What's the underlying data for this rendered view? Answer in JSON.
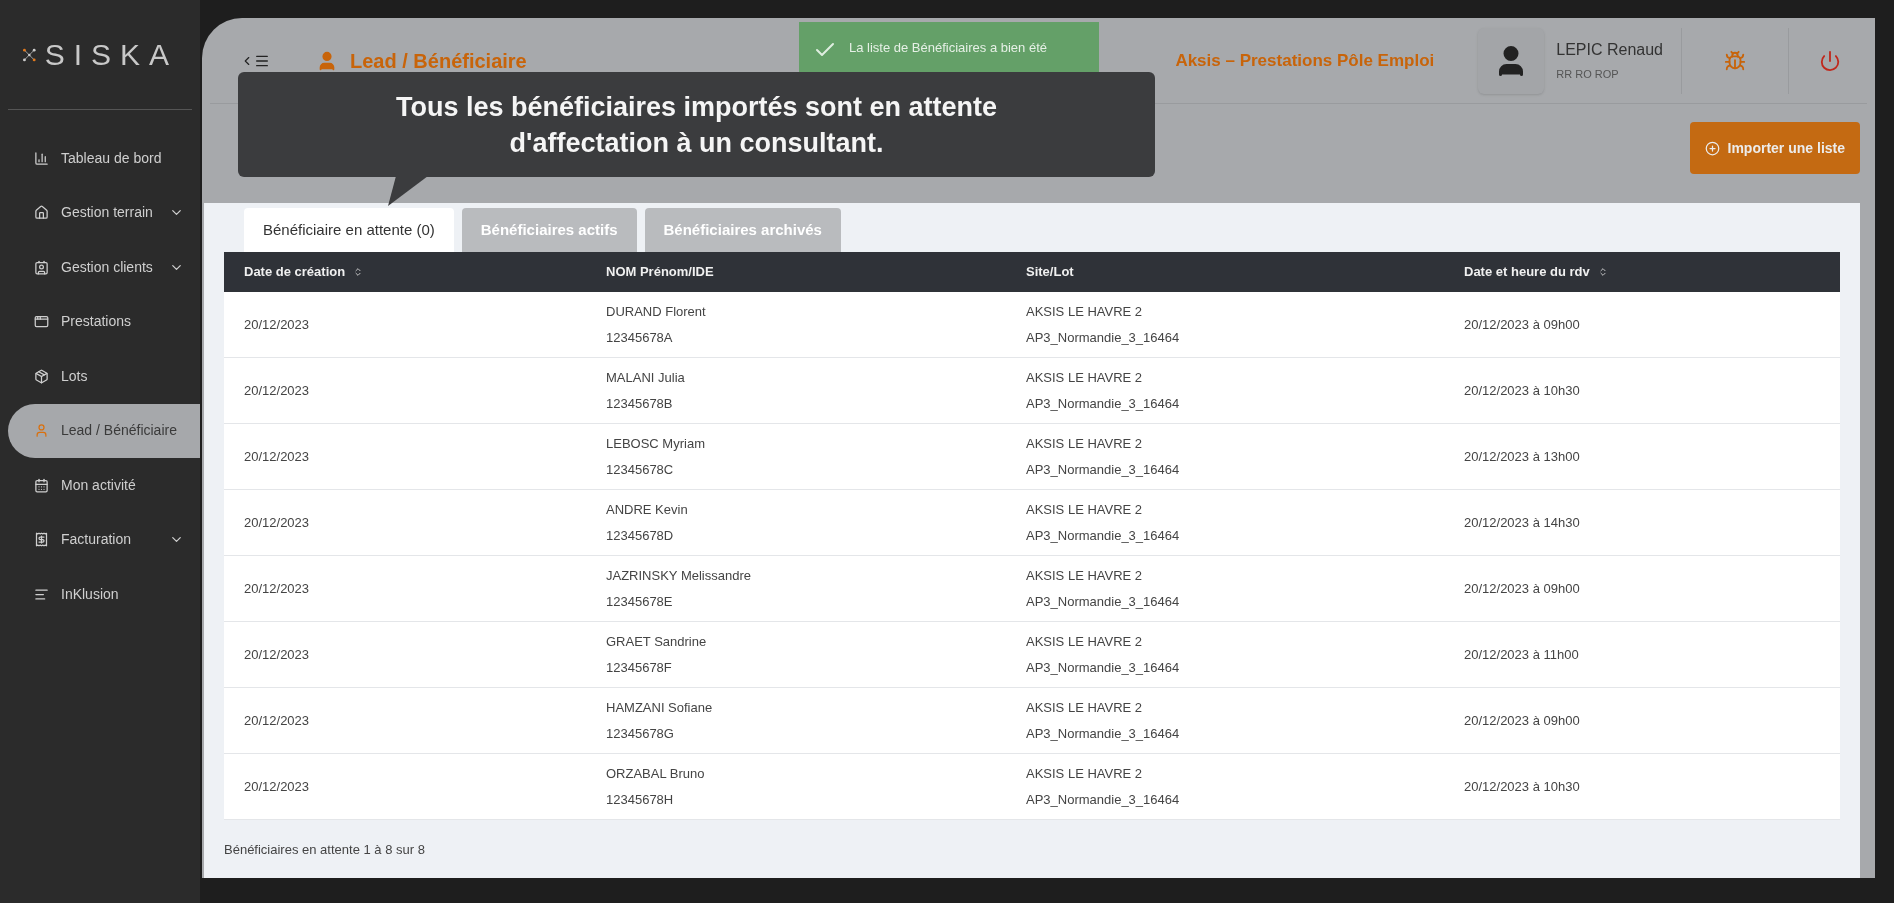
{
  "brand": "SISKA",
  "sidebar": {
    "items": [
      {
        "label": "Tableau de bord",
        "expandable": false,
        "selected": false
      },
      {
        "label": "Gestion terrain",
        "expandable": true,
        "selected": false
      },
      {
        "label": "Gestion clients",
        "expandable": true,
        "selected": false
      },
      {
        "label": "Prestations",
        "expandable": false,
        "selected": false
      },
      {
        "label": "Lots",
        "expandable": false,
        "selected": false
      },
      {
        "label": "Lead / Bénéficiaire",
        "expandable": false,
        "selected": true
      },
      {
        "label": "Mon activité",
        "expandable": false,
        "selected": false
      },
      {
        "label": "Facturation",
        "expandable": true,
        "selected": false
      },
      {
        "label": "InKlusion",
        "expandable": false,
        "selected": false
      }
    ]
  },
  "header": {
    "title": "Lead / Bénéficiaire",
    "organization": "Aksis – Prestations Pôle Emploi",
    "user": {
      "name": "LEPIC Renaud",
      "role": "RR RO ROP"
    }
  },
  "toast": {
    "message": "La liste de Bénéficiaires a bien été"
  },
  "tooltip": {
    "text": "Tous les bénéficiaires importés sont en attente d'affectation à un consultant."
  },
  "import_button": "Importer une liste",
  "tabs": [
    {
      "label": "Bénéficiaire en attente (0)",
      "selected": true
    },
    {
      "label": "Bénéficiaires actifs",
      "selected": false
    },
    {
      "label": "Bénéficiaires archivés",
      "selected": false
    }
  ],
  "table": {
    "columns": [
      {
        "label": "Date de création",
        "sortable": true
      },
      {
        "label": "NOM Prénom/IDE",
        "sortable": false
      },
      {
        "label": "Site/Lot",
        "sortable": false
      },
      {
        "label": "Date et heure du rdv",
        "sortable": true
      }
    ],
    "rows": [
      {
        "date": "20/12/2023",
        "name": "DURAND Florent",
        "ide": "12345678A",
        "site": "AKSIS LE HAVRE 2",
        "lot": "AP3_Normandie_3_16464",
        "rdv": "20/12/2023 à 09h00"
      },
      {
        "date": "20/12/2023",
        "name": "MALANI Julia",
        "ide": "12345678B",
        "site": "AKSIS LE HAVRE 2",
        "lot": "AP3_Normandie_3_16464",
        "rdv": "20/12/2023 à 10h30"
      },
      {
        "date": "20/12/2023",
        "name": "LEBOSC Myriam",
        "ide": "12345678C",
        "site": "AKSIS LE HAVRE 2",
        "lot": "AP3_Normandie_3_16464",
        "rdv": "20/12/2023 à 13h00"
      },
      {
        "date": "20/12/2023",
        "name": "ANDRE Kevin",
        "ide": "12345678D",
        "site": "AKSIS LE HAVRE 2",
        "lot": "AP3_Normandie_3_16464",
        "rdv": "20/12/2023 à 14h30"
      },
      {
        "date": "20/12/2023",
        "name": "JAZRINSKY Melissandre",
        "ide": "12345678E",
        "site": "AKSIS LE HAVRE 2",
        "lot": "AP3_Normandie_3_16464",
        "rdv": "20/12/2023 à 09h00"
      },
      {
        "date": "20/12/2023",
        "name": "GRAET Sandrine",
        "ide": "12345678F",
        "site": "AKSIS LE HAVRE 2",
        "lot": "AP3_Normandie_3_16464",
        "rdv": "20/12/2023 à 11h00"
      },
      {
        "date": "20/12/2023",
        "name": "HAMZANI Sofiane",
        "ide": "12345678G",
        "site": "AKSIS LE HAVRE 2",
        "lot": "AP3_Normandie_3_16464",
        "rdv": "20/12/2023 à 09h00"
      },
      {
        "date": "20/12/2023",
        "name": "ORZABAL Bruno",
        "ide": "12345678H",
        "site": "AKSIS LE HAVRE 2",
        "lot": "AP3_Normandie_3_16464",
        "rdv": "20/12/2023 à 10h30"
      }
    ]
  },
  "footer": "Bénéficiaires en attente 1 à 8 sur 8"
}
